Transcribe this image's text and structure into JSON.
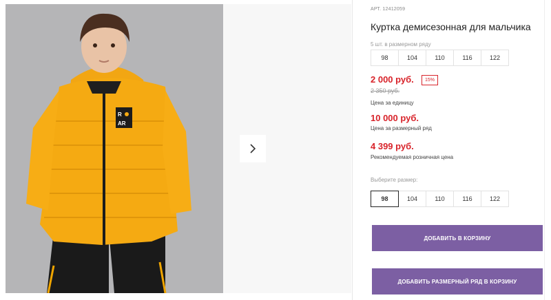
{
  "product": {
    "sku": "АРТ. 12412059",
    "title": "Куртка демисезонная для мальчика",
    "size_row_label": "5 шт. в размерном ряду",
    "sizes": [
      "98",
      "104",
      "110",
      "116",
      "122"
    ]
  },
  "pricing": {
    "price": "2 000 руб.",
    "discount": "15%",
    "old_price": "2 350 руб.",
    "unit_note": "Цена за единицу",
    "row_price": "10 000 руб.",
    "row_note": "Цена за размерный ряд",
    "retail_price": "4 399 руб.",
    "retail_note": "Рекомендуемая розничная цена",
    "accent_color": "#d8232a"
  },
  "size_picker": {
    "label": "Выберите размер:",
    "options": [
      "98",
      "104",
      "110",
      "116",
      "122"
    ],
    "selected": "98"
  },
  "actions": {
    "add_to_cart": "ДОБАВИТЬ В КОРЗИНУ",
    "add_row_to_cart": "ДОБАВИТЬ РАЗМЕРНЫЙ РЯД В КОРЗИНУ",
    "button_color": "#7c5fa3"
  },
  "gallery": {
    "next_icon": "chevron-right-icon",
    "image_alt": "Мальчик в жёлтой куртке"
  }
}
